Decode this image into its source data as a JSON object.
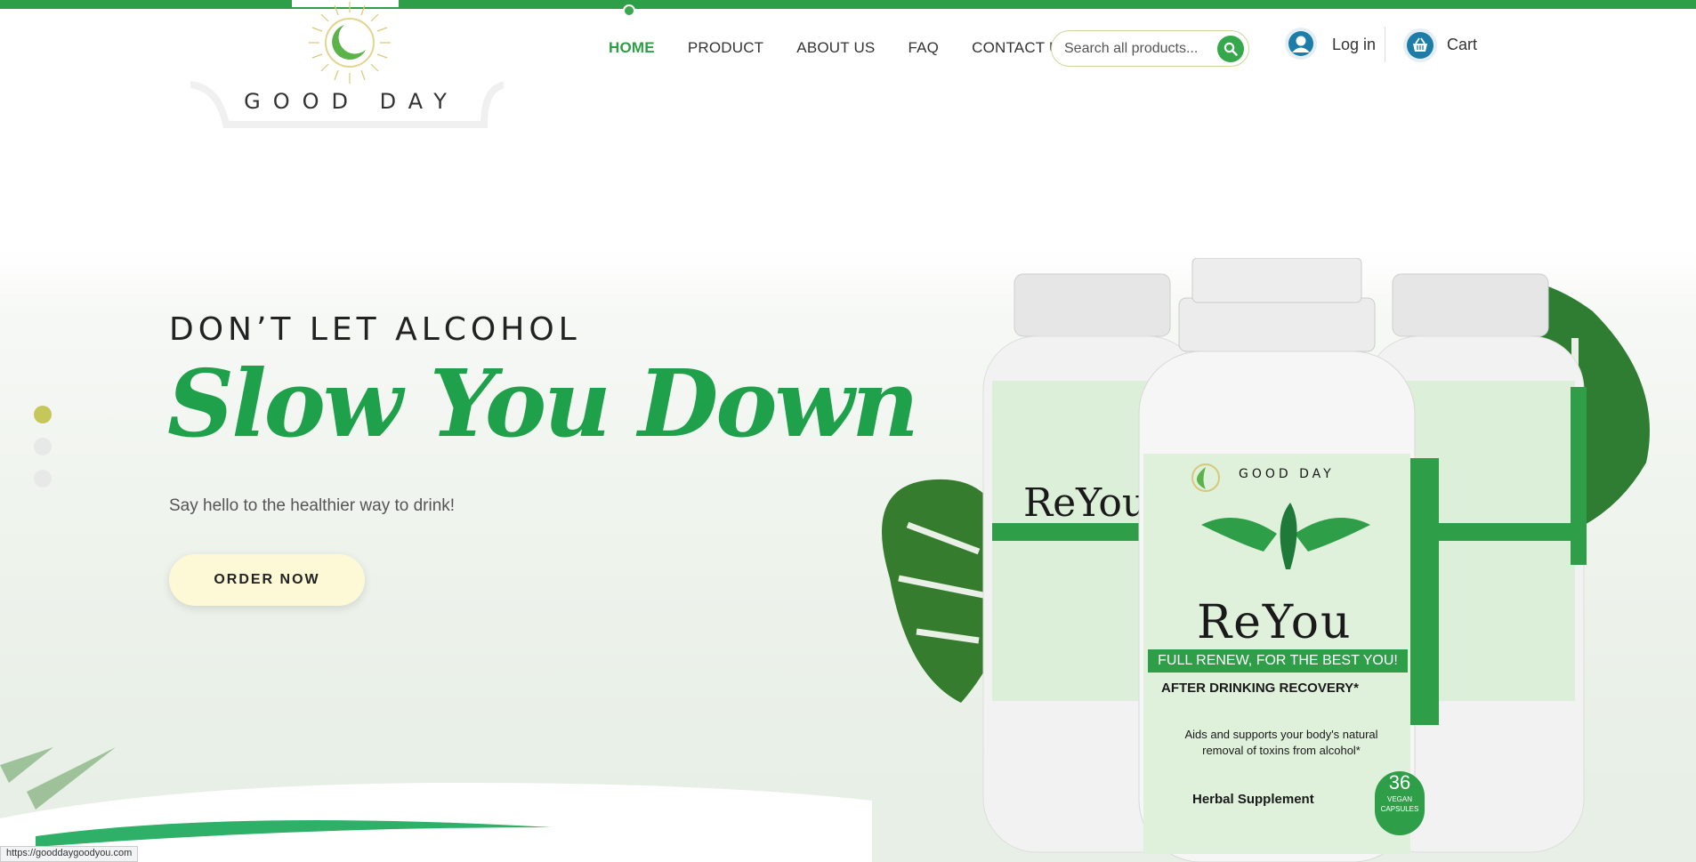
{
  "brand": {
    "name": "GOOD DAY"
  },
  "colors": {
    "accent": "#2e9e48",
    "headline": "#1fa14c",
    "button_bg": "#fdf9d6"
  },
  "nav": {
    "items": [
      {
        "label": "HOME",
        "active": true
      },
      {
        "label": "PRODUCT",
        "active": false
      },
      {
        "label": "ABOUT US",
        "active": false
      },
      {
        "label": "FAQ",
        "active": false
      },
      {
        "label": "CONTACT US",
        "active": false
      }
    ]
  },
  "search": {
    "placeholder": "Search all products...",
    "icon": "search-icon"
  },
  "account": {
    "login_label": "Log in",
    "cart_label": "Cart"
  },
  "hero": {
    "kicker": "DON’T LET ALCOHOL",
    "headline": "Slow You Down",
    "subtitle": "Say hello to the healthier way to drink!",
    "cta_label": "ORDER NOW"
  },
  "slider": {
    "count": 3,
    "active_index": 0
  },
  "product": {
    "brand": "GOOD DAY",
    "name": "ReYou",
    "banner": "FULL RENEW, FOR THE BEST YOU!",
    "claim": "AFTER DRINKING RECOVERY*",
    "description_line1": "Aids and supports your body's natural",
    "description_line2": "removal of toxins from alcohol*",
    "type": "Herbal Supplement",
    "count": "36",
    "count_unit_line1": "VEGAN",
    "count_unit_line2": "CAPSULES"
  },
  "status_bar": {
    "url": "https://gooddaygoodyou.com"
  }
}
